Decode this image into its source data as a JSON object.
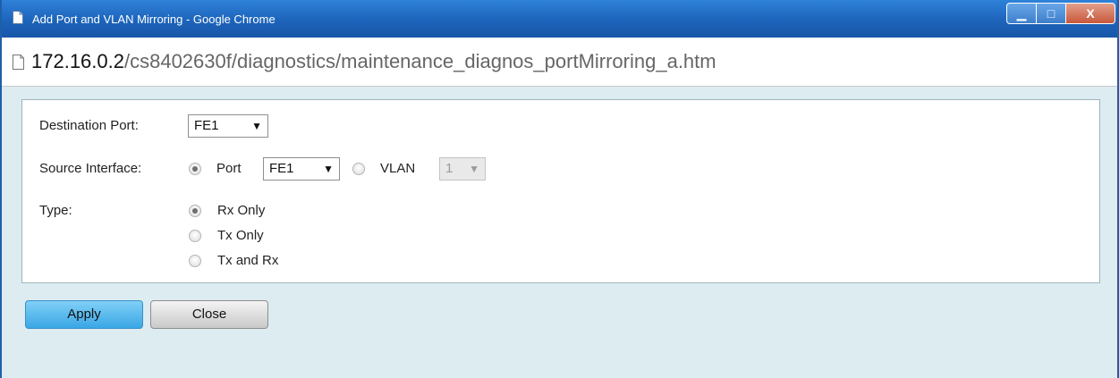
{
  "window": {
    "title": "Add Port and VLAN Mirroring - Google Chrome",
    "minimize_glyph": "▁",
    "maximize_glyph": "□",
    "close_glyph": "X"
  },
  "address_bar": {
    "host": "172.16.0.2",
    "path": "/cs8402630f/diagnostics/maintenance_diagnos_portMirroring_a.htm"
  },
  "form": {
    "destination_port": {
      "label": "Destination Port:",
      "value": "FE1"
    },
    "source_interface": {
      "label": "Source Interface:",
      "port_option": {
        "label": "Port",
        "checked": true
      },
      "port_select_value": "FE1",
      "vlan_option": {
        "label": "VLAN",
        "checked": false
      },
      "vlan_select_value": "1",
      "vlan_select_disabled": true
    },
    "type": {
      "label": "Type:",
      "options": [
        {
          "label": "Rx Only",
          "checked": true
        },
        {
          "label": "Tx Only",
          "checked": false
        },
        {
          "label": "Tx and Rx",
          "checked": false
        }
      ]
    }
  },
  "buttons": {
    "apply": "Apply",
    "close": "Close"
  },
  "colors": {
    "titlebar": "#1d64bb",
    "content_background": "#dcecf1",
    "apply_button": "#3aa7e6"
  },
  "icons": {
    "tab_page": "page-icon",
    "address_page": "document-icon",
    "dropdown": "triangle-down"
  }
}
